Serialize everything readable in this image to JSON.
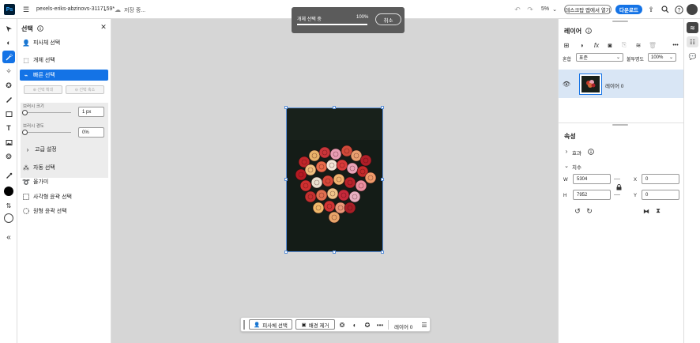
{
  "topbar": {
    "doc_name": "pexels-eriks-abzinovs-3117159*",
    "save_status": "저장 중...",
    "zoom": "5%",
    "open_desktop_label": "데스크탑 앱에서 열기",
    "download_label": "다운로드"
  },
  "toolbar": {
    "tools": [
      "move-tool",
      "blur-tool",
      "quick-selection-tool",
      "healing-tool",
      "clone-tool",
      "brush-tool",
      "shape-tool",
      "type-tool",
      "image-tool",
      "adjust-tool",
      "eyedropper-tool"
    ],
    "active_tool": "quick-selection-tool",
    "foreground_color": "#000000",
    "background_color": "#ffffff"
  },
  "select_panel": {
    "title": "선택",
    "items_top": [
      {
        "label": "피사체 선택"
      },
      {
        "label": "개체 선택"
      },
      {
        "label": "빠른 선택"
      }
    ],
    "add_selection": "선택 확대",
    "subtract_selection": "선택 축소",
    "brush_size_label": "브러시 크기",
    "brush_size_value": "1 px",
    "brush_hardness_label": "브러시 경도",
    "brush_hardness_value": "0%",
    "advanced_label": "고급 설정",
    "items_bottom": [
      {
        "label": "자동 선택"
      },
      {
        "label": "올가미"
      },
      {
        "label": "사각형 윤곽 선택"
      },
      {
        "label": "원형 윤곽 선택"
      }
    ]
  },
  "toast": {
    "message": "개체 선택 중",
    "percent": "100%",
    "progress": 1.0,
    "cancel_label": "취소"
  },
  "taskbar": {
    "select_subject": "피사체 선택",
    "remove_background": "배경 제거",
    "layer_name": "레이어 0"
  },
  "layers_panel": {
    "title": "레이어",
    "blend_label": "혼합",
    "blend_value": "표준",
    "opacity_label": "불투명도",
    "opacity_value": "100%",
    "layer_name": "레이어 0"
  },
  "properties_panel": {
    "title": "속성",
    "effects_label": "효과",
    "dimensions_label": "치수",
    "w_label": "W",
    "w_value": "5304",
    "h_label": "H",
    "h_value": "7952",
    "x_label": "X",
    "x_value": "0",
    "y_label": "Y",
    "y_value": "0"
  },
  "colors": {
    "accent": "#1473e6",
    "canvas_bg": "#d6d6d6",
    "toast_bg": "#5b5b5b"
  }
}
